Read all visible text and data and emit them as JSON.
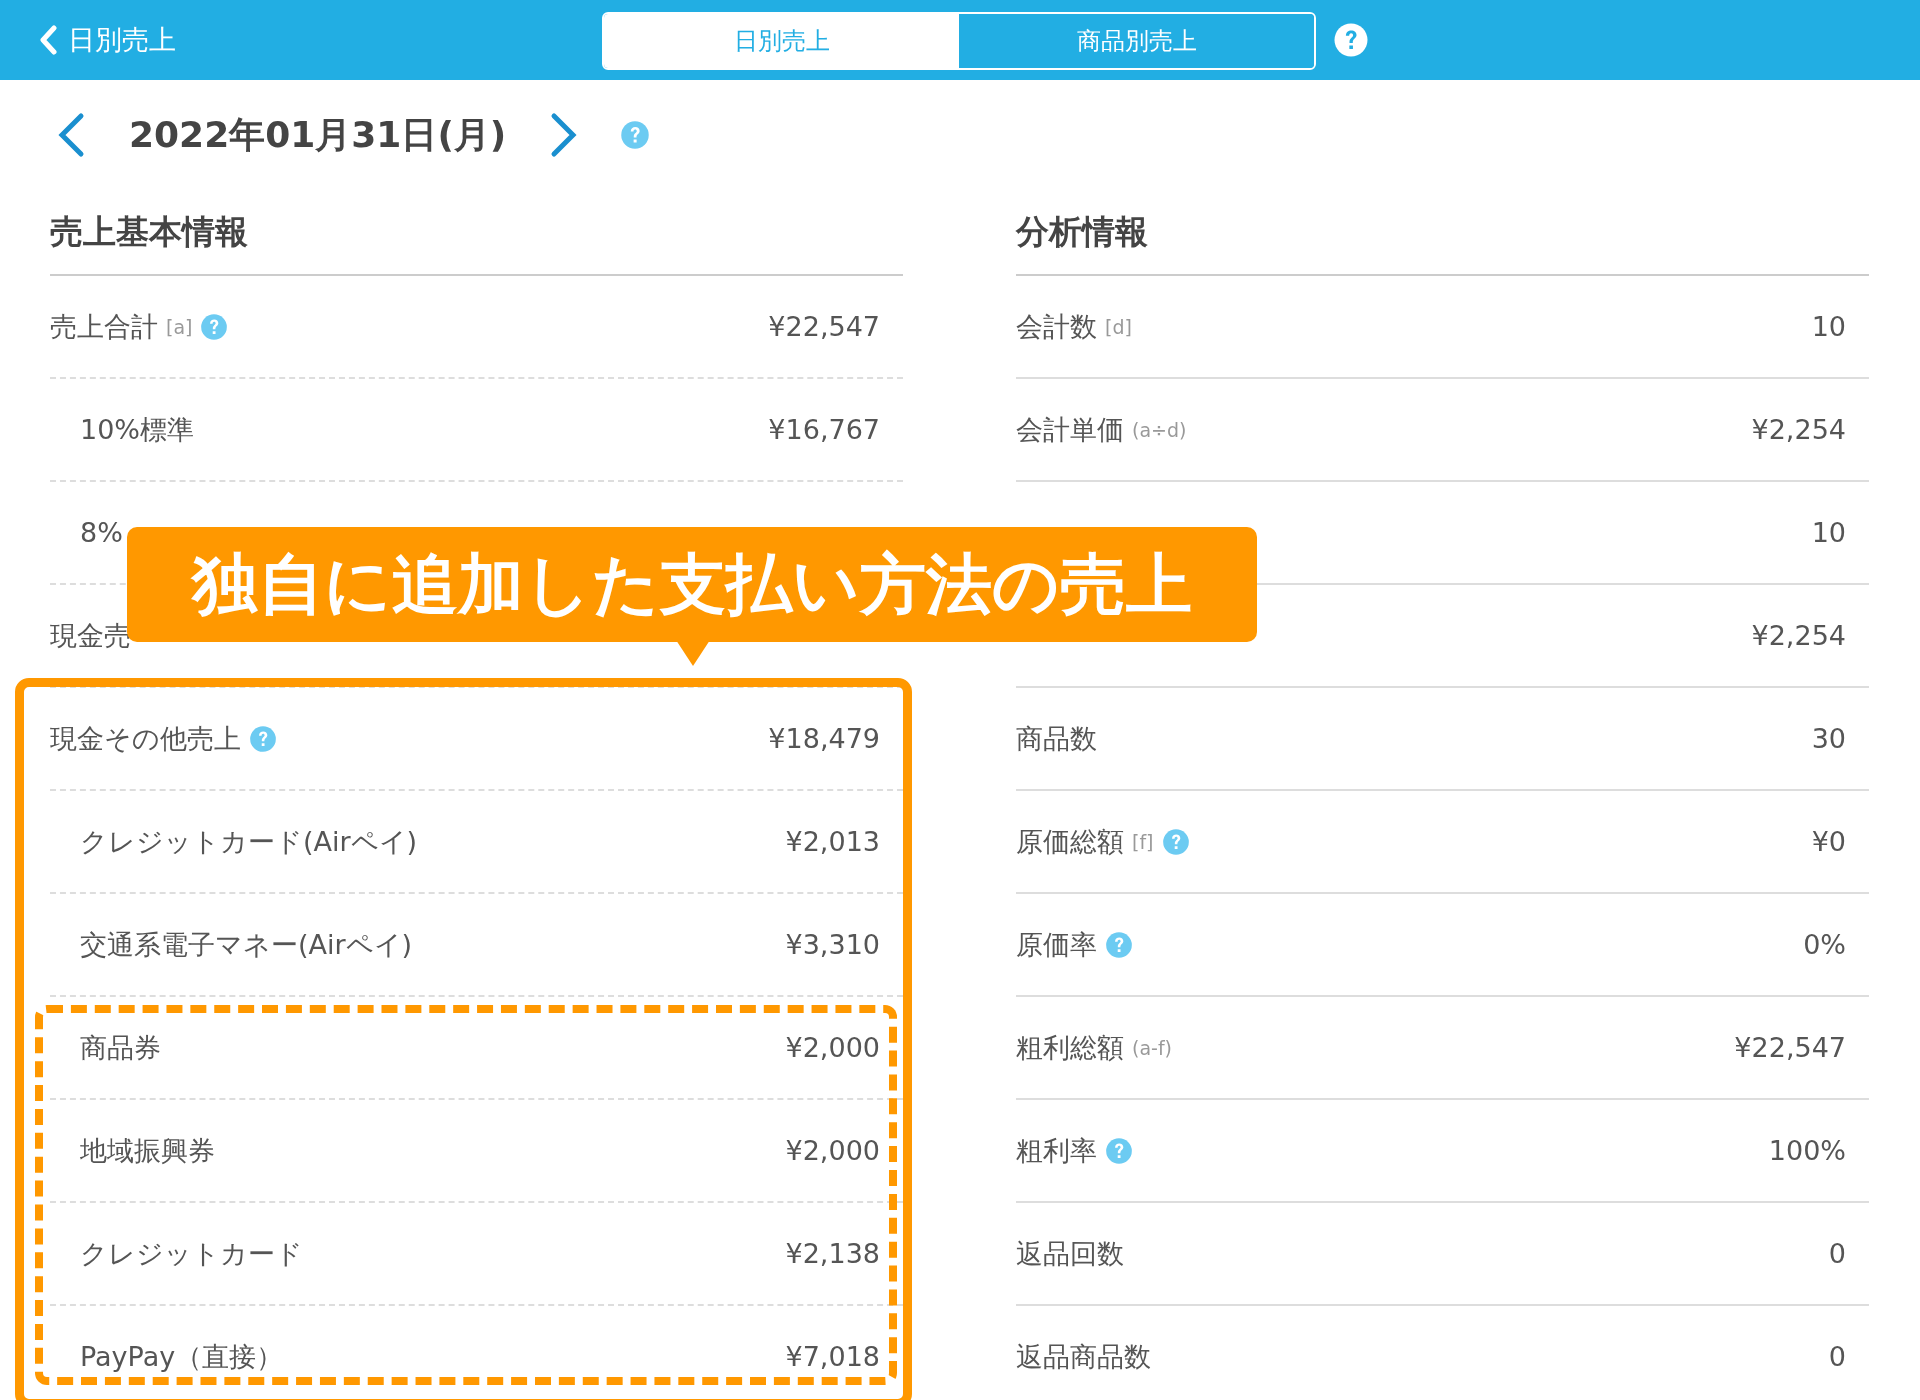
{
  "header": {
    "back_label": "日別売上",
    "tabs": [
      {
        "label": "日別売上",
        "selected": true
      },
      {
        "label": "商品別売上",
        "selected": false
      }
    ]
  },
  "date": "2022年01月31日(月)",
  "sections": [
    {
      "title": "売上基本情報",
      "rows": [
        {
          "label": "売上合計",
          "note": "[a]",
          "help": true,
          "value": "¥22,547",
          "children": [
            {
              "label": "10%標準",
              "value": "¥16,767"
            },
            {
              "label": "8%"
            }
          ]
        },
        {
          "label": "現金売"
        },
        {
          "label": "現金その他売上",
          "help": true,
          "value": "¥18,479",
          "children": [
            {
              "label": "クレジットカード(Airペイ)",
              "value": "¥2,013"
            },
            {
              "label": "交通系電子マネー(Airペイ)",
              "value": "¥3,310"
            },
            {
              "label": "商品券",
              "value": "¥2,000"
            },
            {
              "label": "地域振興券",
              "value": "¥2,000"
            },
            {
              "label": "クレジットカード",
              "value": "¥2,138"
            },
            {
              "label": "PayPay（直接）",
              "value": "¥7,018"
            }
          ]
        }
      ]
    },
    {
      "title": "分析情報",
      "rows": [
        {
          "label": "会計数",
          "note": "[d]",
          "value": "10"
        },
        {
          "label": "会計単価",
          "note": "(a÷d)",
          "value": "¥2,254"
        },
        {
          "value": "10"
        },
        {
          "value": "¥2,254"
        },
        {
          "label": "商品数",
          "value": "30"
        },
        {
          "label": "原価総額",
          "note": "[f]",
          "help": true,
          "value": "¥0"
        },
        {
          "label": "原価率",
          "help": true,
          "value": "0%"
        },
        {
          "label": "粗利総額",
          "note": "(a-f)",
          "value": "¥22,547"
        },
        {
          "label": "粗利率",
          "help": true,
          "value": "100%"
        },
        {
          "label": "返品回数",
          "value": "0"
        },
        {
          "label": "返品商品数",
          "value": "0"
        }
      ]
    }
  ],
  "callout": "独自に追加した支払い方法の売上"
}
